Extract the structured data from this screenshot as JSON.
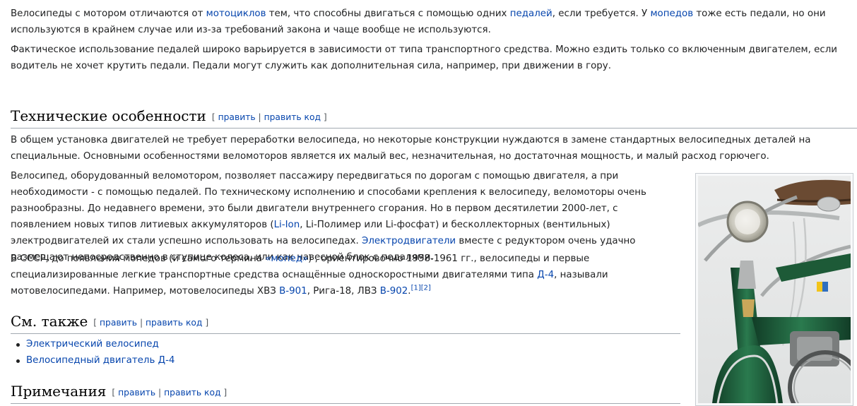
{
  "intro": {
    "p1": [
      {
        "t": "Велосипеды с мотором отличаются от "
      },
      {
        "t": "мотоциклов",
        "link": true
      },
      {
        "t": " тем, что способны двигаться с помощью одних "
      },
      {
        "t": "педалей",
        "link": true
      },
      {
        "t": ", если требуется. У "
      },
      {
        "t": "мопедов",
        "link": true
      },
      {
        "t": " тоже есть педали, но они используются в крайнем случае или из-за требований закона и чаще вообще не используются."
      }
    ],
    "p2": "Фактическое использование педалей широко варьируется в зависимости от типа транспортного средства. Можно ездить только со включенным двигателем, если водитель не хочет крутить педали. Педали могут служить как дополнительная сила, например, при движении в гору."
  },
  "sections": {
    "tech": {
      "title": "Технические особенности",
      "edit": "править",
      "edit_code": "править код"
    },
    "see_also": {
      "title": "См. также",
      "edit": "править",
      "edit_code": "править код"
    },
    "notes": {
      "title": "Примечания",
      "edit": "править",
      "edit_code": "править код"
    }
  },
  "tech": {
    "p1": "В общем установка двигателей не требует переработки велосипеда, но некоторые конструкции нуждаются в замене стандартных велосипедных деталей на специальные. Основными особенностями веломоторов является их малый вес, незначительная, но достаточная мощность, и малый расход горючего.",
    "p2": [
      {
        "t": "Велосипед, оборудованный веломотором, позволяет пассажиру передвигаться по дорогам с помощью двигателя, а при необходимости - с помощью педалей. По техническому исполнению и способами крепления к велосипеду, веломоторы очень разнообразны. До недавнего времени, это были двигатели внутреннего сгорания. Но в первом десятилетии 2000-лет, с появлением новых типов литиевых аккумуляторов ("
      },
      {
        "t": "Li-Ion",
        "link": true
      },
      {
        "t": ", Li-Полимер или Li-фосфат) и бесколлекторных (вентильных) электродвигателей их стали успешно использовать на велосипедах. "
      },
      {
        "t": "Электродвигатели",
        "link": true
      },
      {
        "t": " вместе с редуктором очень удачно размещают непосредственно в ступице колеса, или как навесной блок с педалями."
      }
    ],
    "p3": [
      {
        "t": "В СССР, до появления мопедов (и самого термина "
      },
      {
        "t": "«мопед»",
        "link": true
      },
      {
        "t": ") , ориентировочно 1958-1961 гг., велосипеды и первые специализированные легкие транспортные средства оснащённые односкоростными двигателями типа "
      },
      {
        "t": "Д-4",
        "link": true
      },
      {
        "t": ", называли мотовелосипедами. Например, мотовелосипеды ХВЗ "
      },
      {
        "t": "В-901",
        "link": true
      },
      {
        "t": ", Рига-18, ЛВЗ "
      },
      {
        "t": "В-902",
        "link": true
      },
      {
        "t": ".",
        "link": false
      },
      {
        "t": "[1]",
        "link": true,
        "sup": true
      },
      {
        "t": "[2]",
        "link": true,
        "sup": true
      }
    ]
  },
  "see_also": {
    "items": [
      "Электрический велосипед",
      "Велосипедный двигатель Д-4"
    ]
  },
  "colors": {
    "link": "#0645ad",
    "text": "#202122",
    "frame_green": "#1f5a3a"
  }
}
